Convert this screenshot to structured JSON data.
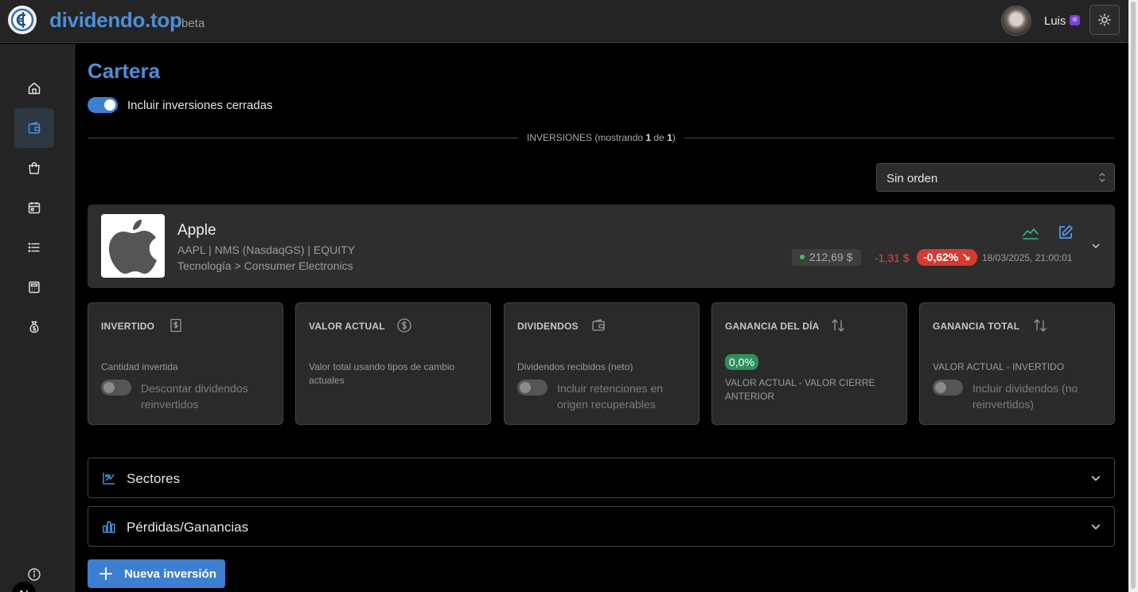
{
  "header": {
    "logo_text": "dividendo.top",
    "logo_suffix": "beta",
    "user_name": "Luis",
    "user_badge": "⚛"
  },
  "page": {
    "title": "Cartera",
    "toggle_closed_label": "Incluir inversiones cerradas",
    "divider_prefix": "INVERSIONES (mostrando ",
    "divider_shown": "1",
    "divider_mid": " de ",
    "divider_total": "1",
    "divider_suffix": ")",
    "sort_value": "Sin orden"
  },
  "investment": {
    "name": "Apple",
    "ticker_line": "AAPL | NMS (NasdaqGS) | EQUITY",
    "sector_line": "Tecnología > Consumer Electronics",
    "price": "212,69 $",
    "change_abs": "-1,31 $",
    "change_pct": "-0,62%",
    "change_arrow": "↘",
    "date": "18/03/2025, 21:00:01"
  },
  "stats": [
    {
      "title": "INVERTIDO",
      "desc": "Cantidad invertida",
      "toggle_label": "Descontar dividendos reinvertidos"
    },
    {
      "title": "VALOR ACTUAL",
      "desc": "Valor total usando tipos de cambio actuales"
    },
    {
      "title": "DIVIDENDOS",
      "desc": "Dividendos recibidos (neto)",
      "toggle_label": "Incluir retenciones en origen recuperables"
    },
    {
      "title": "GANANCIA DEL DÍA",
      "pill": "0,0%",
      "desc": "VALOR ACTUAL - VALOR CIERRE ANTERIOR"
    },
    {
      "title": "GANANCIA TOTAL",
      "desc": "VALOR ACTUAL - INVERTIDO",
      "toggle_label": "Incluir dividendos (no reinvertidos)"
    }
  ],
  "accordions": [
    {
      "label": "Sectores"
    },
    {
      "label": "Pérdidas/Ganancias"
    }
  ],
  "new_button_label": "Nueva inversión",
  "sidebar": {
    "items": [
      "home-icon",
      "wallet-icon",
      "shopping-bag-icon",
      "calendar-icon",
      "list-icon",
      "receipt-icon",
      "money-bag-icon"
    ],
    "bottom": [
      "info-icon"
    ],
    "bottom_letter": "N"
  },
  "colors": {
    "accent": "#4c8fd6",
    "primary_button": "#3d7fd0",
    "negative": "#d63a33",
    "positive": "#2f8f5b"
  }
}
